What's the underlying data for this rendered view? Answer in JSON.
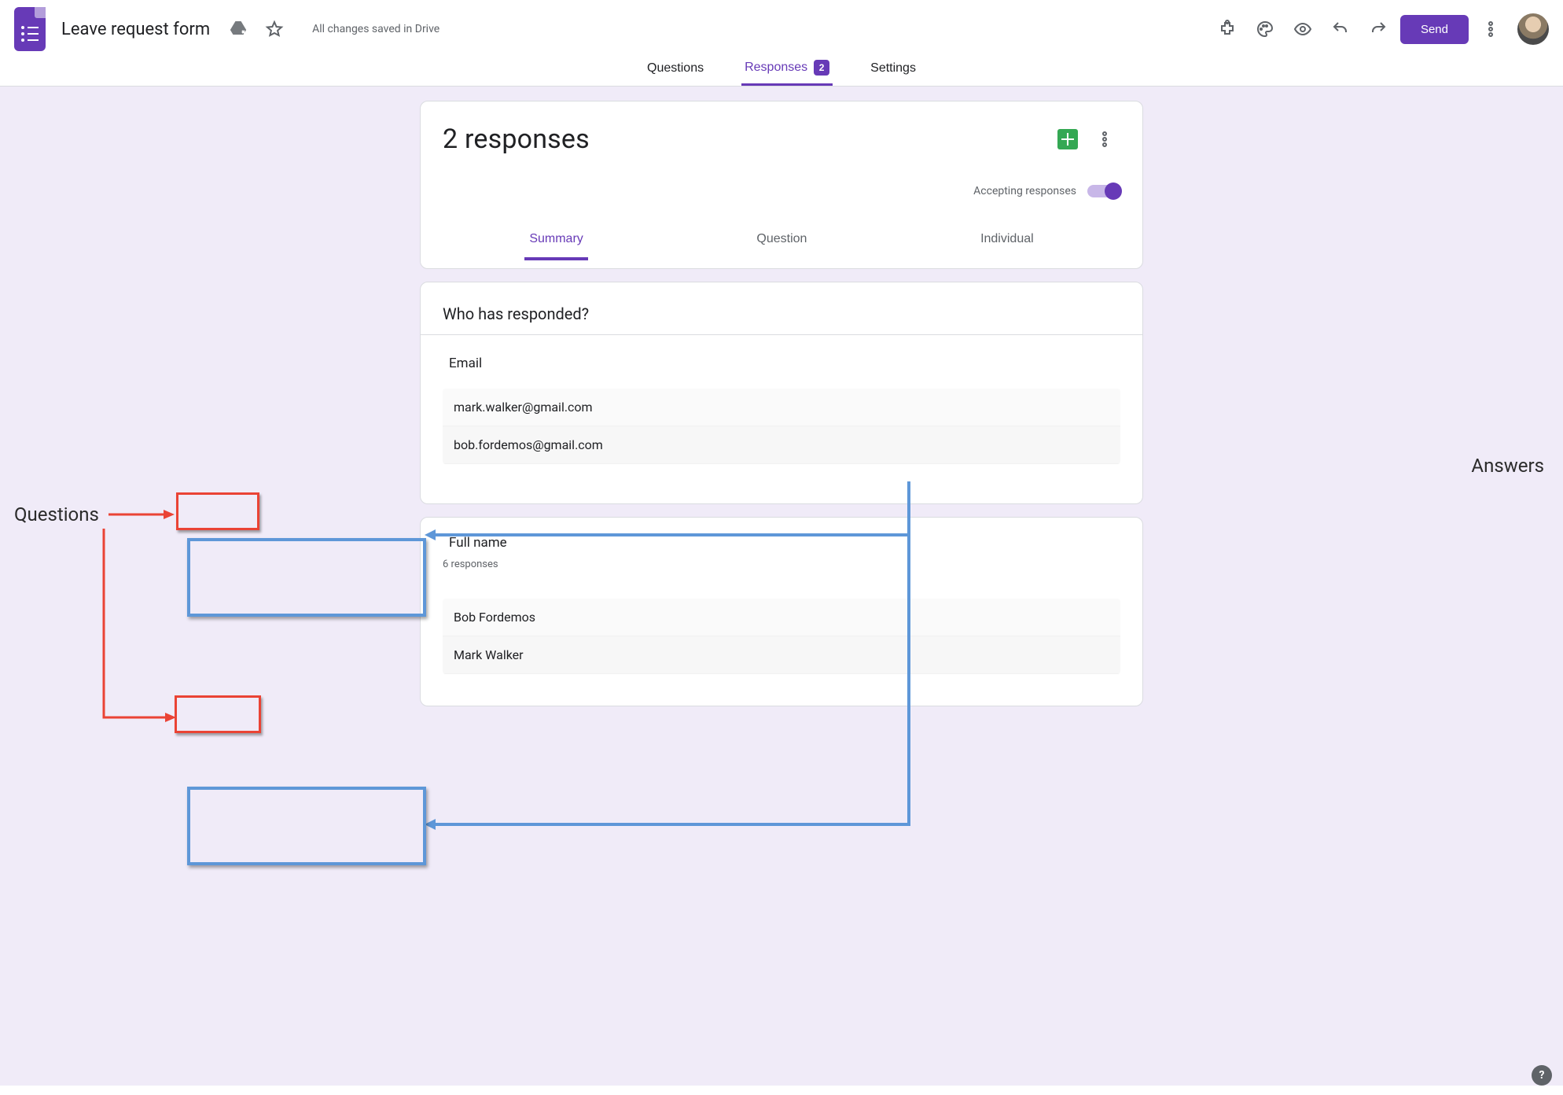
{
  "header": {
    "doc_title": "Leave request form",
    "save_status": "All changes saved in Drive",
    "send_label": "Send"
  },
  "top_tabs": {
    "questions": "Questions",
    "responses": "Responses",
    "responses_count": "2",
    "settings": "Settings"
  },
  "responses": {
    "count_label": "2 responses",
    "accepting_label": "Accepting responses",
    "sub_tabs": {
      "summary": "Summary",
      "question": "Question",
      "individual": "Individual"
    },
    "who_title": "Who has responded?",
    "email_section": {
      "label": "Email",
      "answers": [
        "mark.walker@gmail.com",
        "bob.fordemos@gmail.com"
      ]
    },
    "fullname_section": {
      "label": "Full name",
      "count": "6 responses",
      "answers": [
        "Bob Fordemos",
        "Mark Walker"
      ]
    }
  },
  "annotations": {
    "questions": "Questions",
    "answers": "Answers"
  },
  "help": "?"
}
